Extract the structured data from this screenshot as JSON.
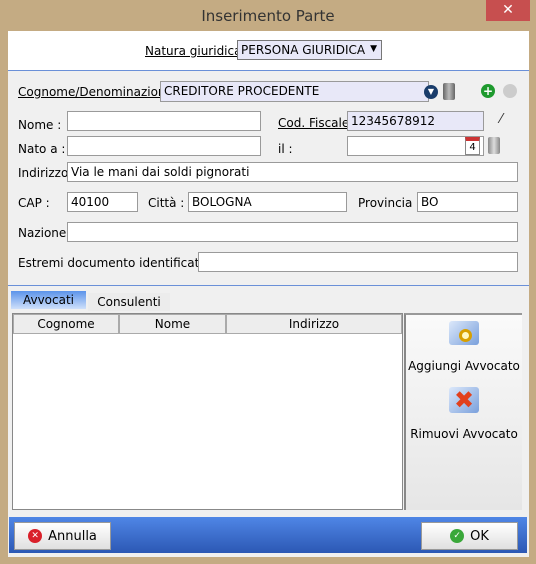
{
  "window": {
    "title": "Inserimento Parte",
    "close": "✕"
  },
  "natura": {
    "label": "Natura giuridica:",
    "value": "PERSONA GIURIDICA"
  },
  "form": {
    "cognome_label": "Cognome/Denominazione",
    "cognome_value": "CREDITORE PROCEDENTE",
    "nome_label": "Nome :",
    "nome_value": "",
    "cf_label": "Cod. Fiscale:",
    "cf_value": "12345678912",
    "nato_label": "Nato a :",
    "nato_value": "",
    "il_label": "il :",
    "il_value": "",
    "calendar_day": "4",
    "indirizzo_label": "Indirizzo:",
    "indirizzo_value": "Via le mani dai soldi pignorati",
    "cap_label": "CAP :",
    "cap_value": "40100",
    "citta_label": "Città :",
    "citta_value": "BOLOGNA",
    "provincia_label": "Provincia :",
    "provincia_value": "BO",
    "nazione_label": "Nazione:",
    "nazione_value": "",
    "estremi_label": "Estremi documento identificativo:",
    "estremi_value": ""
  },
  "tabs": [
    {
      "label": "Avvocati",
      "active": true
    },
    {
      "label": "Consulenti",
      "active": false
    }
  ],
  "grid": {
    "columns": [
      "Cognome",
      "Nome",
      "Indirizzo"
    ],
    "rows": []
  },
  "actions": {
    "add": "Aggiungi Avvocato",
    "remove": "Rimuovi Avvocato"
  },
  "footer": {
    "cancel": "Annulla",
    "ok": "OK"
  }
}
